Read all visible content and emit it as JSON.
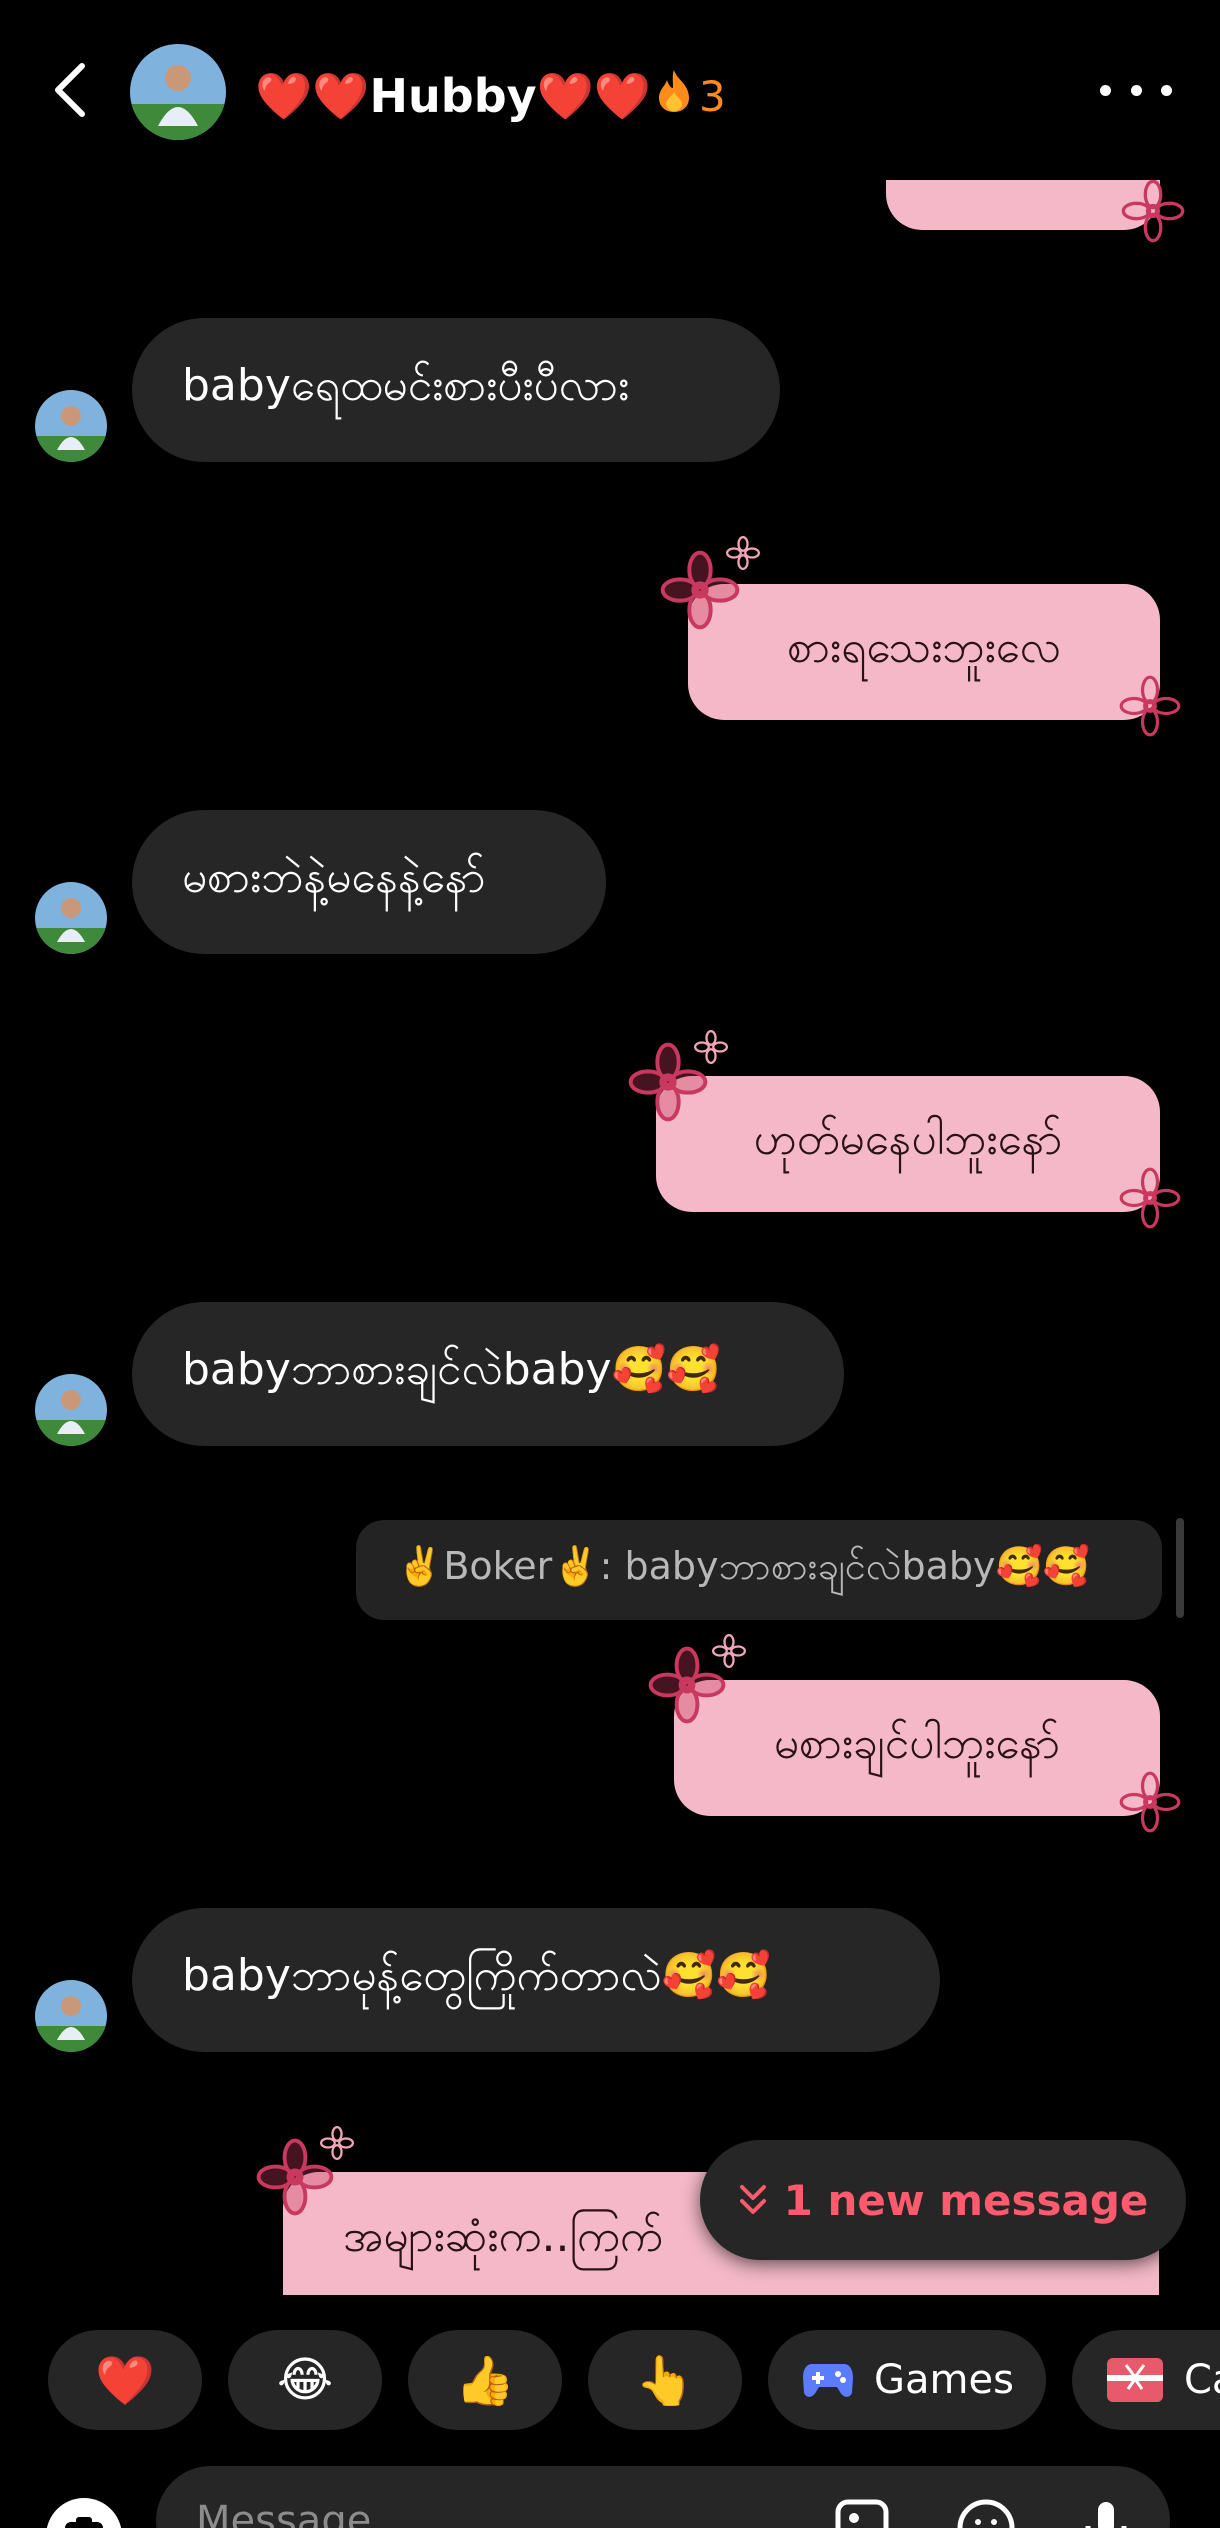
{
  "header": {
    "back_icon": "chevron-left-icon",
    "contact_name": "❤️❤️Hubby❤️❤️",
    "streak_icon": "fire-icon",
    "streak_count": "3",
    "more_icon": "more-horizontal-icon"
  },
  "messages": [
    {
      "from": "them",
      "text": "babyရေထမင်းစားပီးပီလား"
    },
    {
      "from": "me",
      "text": "စားရသေးဘူးလေ"
    },
    {
      "from": "them",
      "text": "မစားဘဲနဲ့မနေနဲ့နော်"
    },
    {
      "from": "me",
      "text": "ဟုတ်မနေပါဘူးနော်"
    },
    {
      "from": "them",
      "text": "babyဘာစားချင်လဲbaby🥰🥰"
    },
    {
      "from": "me",
      "text": "မစားချင်ပါဘူးနော်",
      "reply_to": "✌️Boker✌️: babyဘာစားချင်လဲbaby🥰🥰"
    },
    {
      "from": "them",
      "text": "babyဘာမုန့်တွေကြိုက်တာလဲ🥰🥰"
    },
    {
      "from": "me",
      "text": "အများဆုံးက..ကြက်"
    }
  ],
  "new_message_button": {
    "icon": "double-chevron-down-icon",
    "label": "1 new message"
  },
  "reactions": [
    {
      "icon": "heart-icon",
      "emoji": "❤️"
    },
    {
      "icon": "laughing-emoji-icon",
      "emoji": "😂"
    },
    {
      "icon": "thumbs-up-icon",
      "emoji": "👍"
    },
    {
      "icon": "pointing-hand-icon",
      "emoji": "👆"
    },
    {
      "icon": "gamepad-icon",
      "label": "Games"
    },
    {
      "icon": "gift-icon",
      "label": "Ca"
    }
  ],
  "composer": {
    "camera_icon": "camera-icon",
    "placeholder": "Message",
    "gallery_icon": "gallery-icon",
    "sticker_icon": "sticker-icon",
    "mic_icon": "microphone-icon"
  },
  "colors": {
    "background": "#000000",
    "incoming_bubble": "#262626",
    "outgoing_bubble": "#f4b8c8",
    "flower": "#c9385e",
    "accent": "#ff5a6e",
    "streak": "#ff8c1a"
  }
}
